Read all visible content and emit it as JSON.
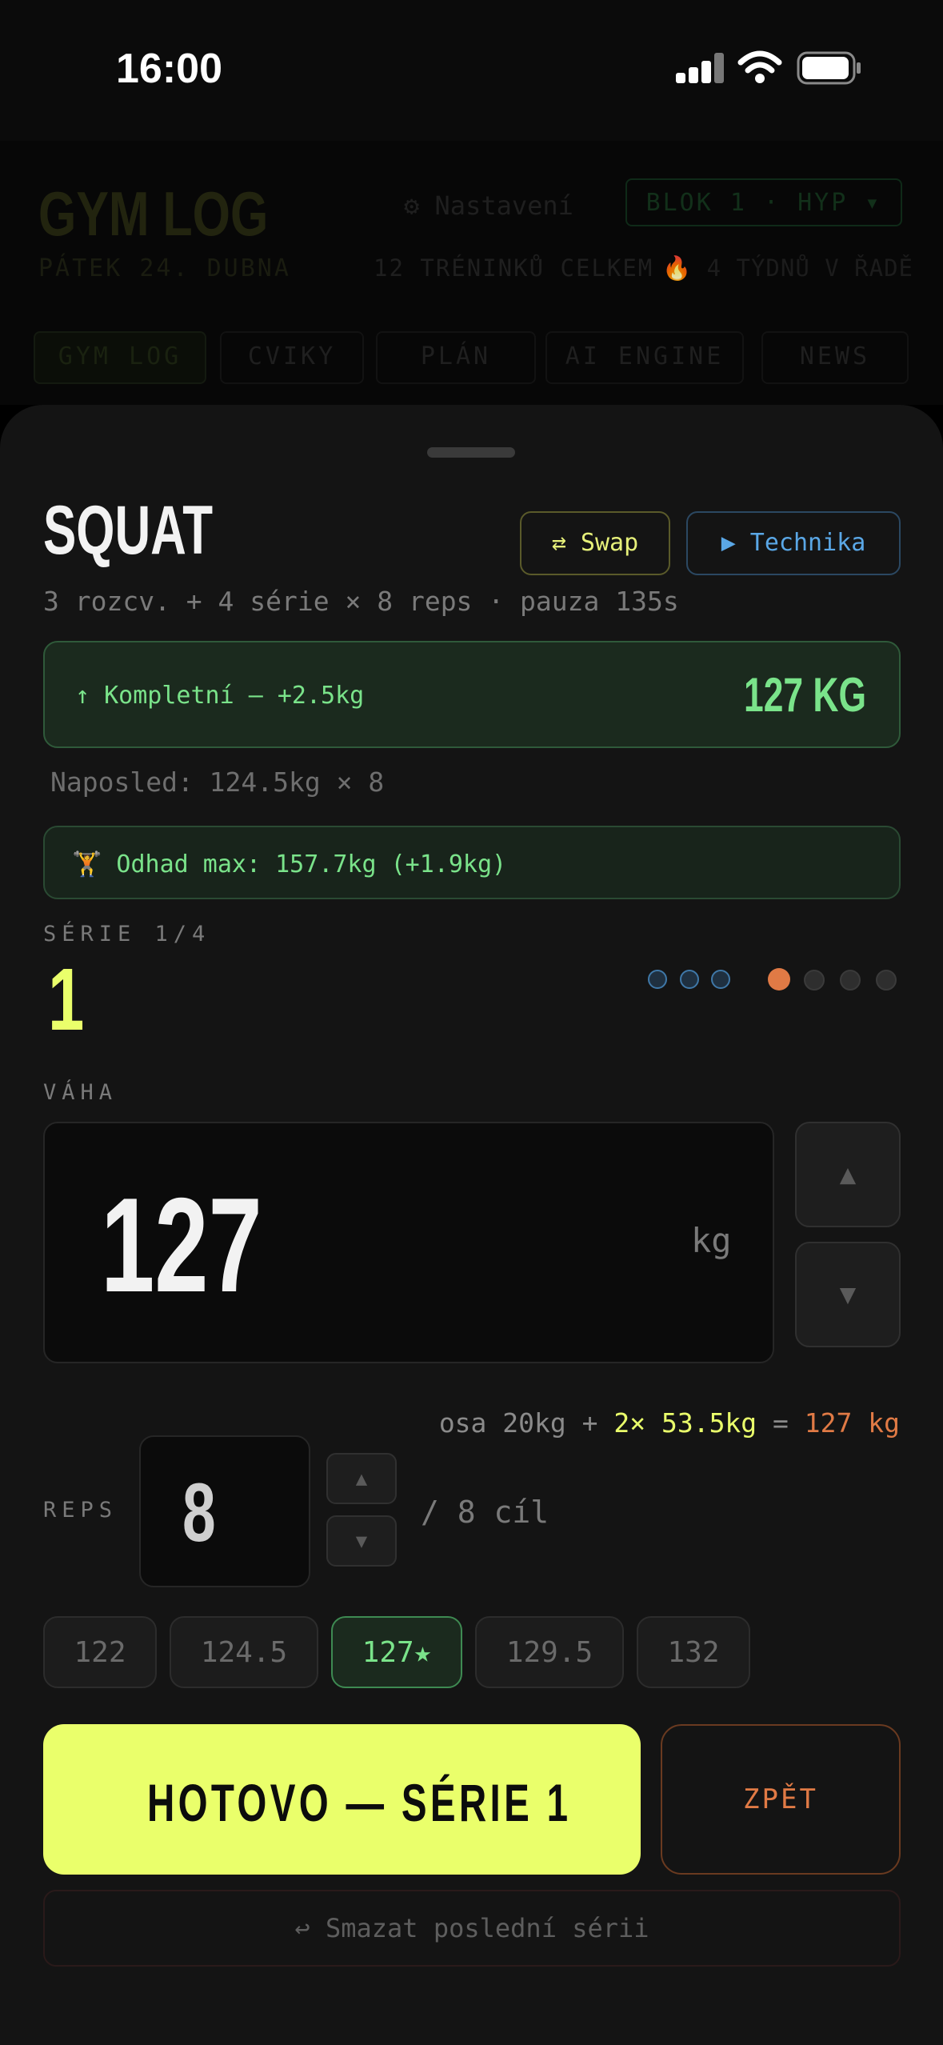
{
  "status_bar": {
    "time": "16:00"
  },
  "background_app": {
    "title": "GYM LOG",
    "date": "PÁTEK 24. DUBNA",
    "settings_label": "⚙ Nastavení",
    "block_selector": "BLOK 1 · HYP ▾",
    "total_workouts": "12 TRÉNINKŮ CELKEM",
    "streak": "🔥 4 TÝDNŮ V ŘADĚ",
    "tabs": [
      "GYM LOG",
      "CVIKY",
      "PLÁN",
      "AI ENGINE",
      "NEWS"
    ]
  },
  "sheet": {
    "exercise_name": "SQUAT",
    "swap_label": "⇄ Swap",
    "technique_label": "▶ Technika",
    "scheme": "3 rozcv. + 4 série × 8 reps · pauza 135s",
    "progression": {
      "text": "↑ Kompletní — +2.5kg",
      "target": "127 KG"
    },
    "last_time": "Naposled: 124.5kg × 8",
    "estimated_max": "🏋 Odhad max: 157.7kg (+1.9kg)",
    "set_label": "SÉRIE 1/4",
    "set_number": "1",
    "warmup_dots": 3,
    "work_sets": 4,
    "current_work_set": 1,
    "weight": {
      "label": "VÁHA",
      "value": "127",
      "unit": "kg",
      "breakdown_prefix": "osa 20kg + ",
      "breakdown_plates": "2× 53.5kg",
      "breakdown_eq": " = ",
      "breakdown_total": "127 kg"
    },
    "reps": {
      "label": "REPS",
      "value": "8",
      "target": "/ 8 cíl"
    },
    "quick_weights": [
      "122",
      "124.5",
      "127★",
      "129.5",
      "132"
    ],
    "selected_quick_weight": 2,
    "done_label": "HOTOVO — SÉRIE 1",
    "back_label": "ZPĚT",
    "delete_last_label": "↩ Smazat poslední sérii",
    "colors": {
      "accent": "#eaff6b",
      "green": "#7ae38a",
      "orange": "#e07a45",
      "blue": "#5aa7e6"
    }
  }
}
